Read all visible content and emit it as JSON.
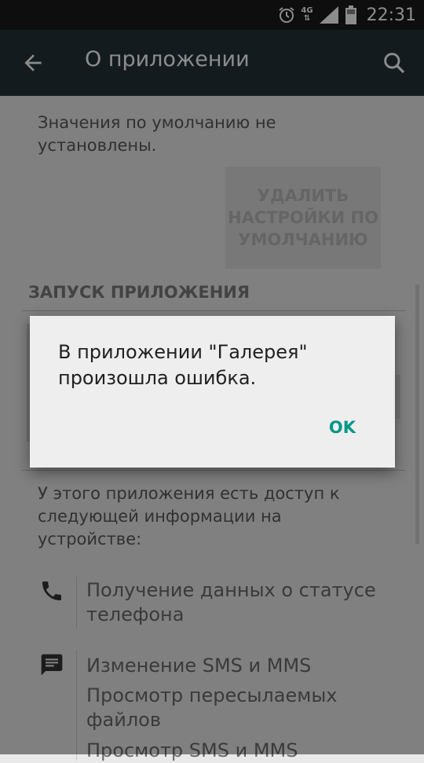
{
  "status_bar": {
    "time": "22:31",
    "network_label": "4G",
    "icons": [
      "alarm-icon",
      "network-4g-icon",
      "signal-icon",
      "battery-icon"
    ]
  },
  "app_bar": {
    "title": "О приложении",
    "back_icon": "arrow-back-icon",
    "search_icon": "search-icon"
  },
  "content": {
    "defaults_text": "Значения по умолчанию не установлены.",
    "clear_defaults_button": "УДАЛИТЬ НАСТРОЙКИ ПО УМОЛЧАНИЮ",
    "section_launch": "ЗАПУСК ПРИЛОЖЕНИЯ",
    "permissions_intro": "У этого приложения есть доступ к следующей информации на устройстве:",
    "permissions": [
      {
        "icon": "phone-icon",
        "items": [
          "Получение данных о статусе телефона"
        ]
      },
      {
        "icon": "message-icon",
        "items": [
          "Изменение SMS и MMS",
          "Просмотр пересылаемых файлов",
          "Просмотр SMS и MMS"
        ]
      }
    ]
  },
  "dialog": {
    "message": "В приложении \"Галерея\" произошла ошибка.",
    "ok_label": "OK"
  },
  "colors": {
    "status_bar": "#1a1b1c",
    "app_bar": "#263238",
    "accent": "#009688",
    "dialog_bg": "#eeeeee"
  }
}
